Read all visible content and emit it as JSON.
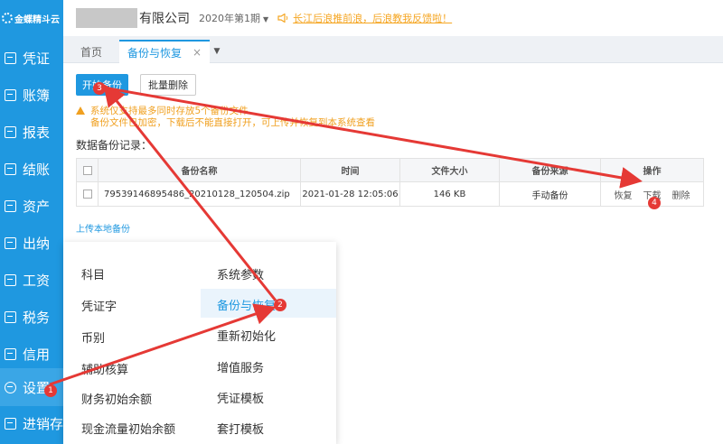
{
  "app": {
    "logo_text": "金蝶精斗云"
  },
  "sidebar": {
    "items": [
      {
        "label": "凭证",
        "icon": "voucher-icon"
      },
      {
        "label": "账簿",
        "icon": "ledger-icon"
      },
      {
        "label": "报表",
        "icon": "report-icon"
      },
      {
        "label": "结账",
        "icon": "closing-icon"
      },
      {
        "label": "资产",
        "icon": "asset-icon"
      },
      {
        "label": "出纳",
        "icon": "cashier-icon"
      },
      {
        "label": "工资",
        "icon": "salary-icon"
      },
      {
        "label": "税务",
        "icon": "tax-icon"
      },
      {
        "label": "信用",
        "icon": "credit-icon"
      },
      {
        "label": "设置",
        "icon": "gear-icon",
        "active": true
      },
      {
        "label": "进销存",
        "icon": "inventory-icon"
      }
    ]
  },
  "header": {
    "company_suffix": "有限公司",
    "period": "2020年第1期",
    "notice": "长江后浪推前浪，后浪教我反馈啦！"
  },
  "tabs": [
    {
      "label": "首页"
    },
    {
      "label": "备份与恢复",
      "close": "×",
      "active": true
    }
  ],
  "toolbar": {
    "start_backup": "开始备份",
    "batch_delete": "批量删除"
  },
  "warnings": [
    "系统仅支持最多同时存放5个备份文件",
    "备份文件已加密，下载后不能直接打开，可上传并恢复到本系统查看"
  ],
  "records": {
    "title": "数据备份记录：",
    "columns": [
      "备份名称",
      "时间",
      "文件大小",
      "备份来源",
      "操作"
    ],
    "rows": [
      {
        "name": "79539146895486_20210128_120504.zip",
        "time": "2021-01-28 12:05:06",
        "size": "146 KB",
        "source": "手动备份",
        "actions": [
          "恢复",
          "下载",
          "删除"
        ]
      }
    ]
  },
  "upload_link": "上传本地备份",
  "settings_menu": {
    "col1": [
      "科目",
      "凭证字",
      "币别",
      "辅助核算",
      "财务初始余额",
      "现金流量初始余额"
    ],
    "col2": [
      "系统参数",
      "备份与恢复",
      "重新初始化",
      "增值服务",
      "凭证模板",
      "套打模板"
    ],
    "active": "备份与恢复"
  },
  "annotations": {
    "badges": [
      "1",
      "2",
      "3",
      "4"
    ],
    "color": "#e53935"
  }
}
